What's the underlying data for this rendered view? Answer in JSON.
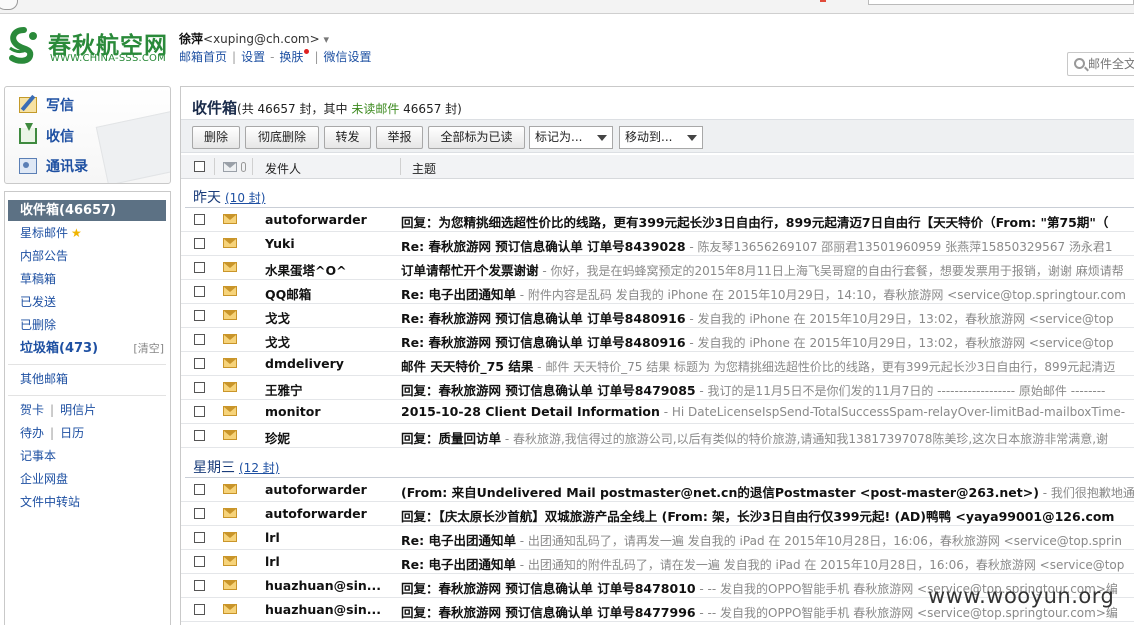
{
  "logo": {
    "cn": "春秋航空网",
    "en": "WWW.CHINA-SSS.COM"
  },
  "user": {
    "name": "徐萍",
    "email": "<xuping@ch.com>",
    "caret": "▾"
  },
  "nav": {
    "home": "邮箱首页",
    "settings": "设置",
    "skin": "换肤",
    "wechat": "微信设置"
  },
  "search": {
    "placeholder": "邮件全文"
  },
  "quick": {
    "write": "写信",
    "inbox": "收信",
    "contacts": "通讯录"
  },
  "folders": {
    "inbox": "收件箱(46657)",
    "starred": "星标邮件",
    "notice": "内部公告",
    "drafts": "草稿箱",
    "sent": "已发送",
    "deleted": "已删除",
    "spam": "垃圾箱(473)",
    "spam_clear": "[清空]",
    "other": "其他邮箱",
    "greeting_card": "贺卡",
    "postcard": "明信片",
    "todo": "待办",
    "calendar": "日历",
    "notes": "记事本",
    "netdisk": "企业网盘",
    "transfer": "文件中转站"
  },
  "header": {
    "title": "收件箱",
    "count_prefix": "(共 46657 封，其中 ",
    "unread_label": "未读邮件",
    "count_suffix": " 46657 封)"
  },
  "toolbar": {
    "delete": "删除",
    "perm_delete": "彻底删除",
    "forward": "转发",
    "report": "举报",
    "mark_all_read": "全部标为已读",
    "mark_as": "标记为...",
    "move_to": "移动到..."
  },
  "columns": {
    "sender": "发件人",
    "subject": "主题"
  },
  "groups": [
    {
      "label": "昨天",
      "count": "(10 封)",
      "emails": [
        {
          "sender": "autoforwarder",
          "subject": "回复：为您精挑细选超性价比的线路，更有399元起长沙3日自由行，899元起清迈7日自由行【天天特价（From: \"第75期\"（",
          "preview": ""
        },
        {
          "sender": "Yuki",
          "subject": "Re: 春秋旅游网 预订信息确认单 订单号8439028",
          "preview": " - 陈友琴13656269107 邵丽君13501960959 张燕萍15850329567 汤永君1"
        },
        {
          "sender": "水果蛋塔^O^",
          "subject": "订单请帮忙开个发票谢谢",
          "preview": " - 你好，我是在蚂蜂窝预定的2015年8月11日上海飞吴哥窟的自由行套餐，想要发票用于报销，谢谢 麻烦请帮"
        },
        {
          "sender": "QQ邮箱",
          "subject": "Re: 电子出团通知单",
          "preview": " - 附件内容是乱码 发自我的 iPhone 在 2015年10月29日，14:10，春秋旅游网 <service@top.springtour.com"
        },
        {
          "sender": "戈戈",
          "subject": "Re: 春秋旅游网 预订信息确认单 订单号8480916",
          "preview": " - 发自我的 iPhone 在 2015年10月29日，13:02，春秋旅游网 <service@top"
        },
        {
          "sender": "戈戈",
          "subject": "Re: 春秋旅游网 预订信息确认单 订单号8480916",
          "preview": " - 发自我的 iPhone 在 2015年10月29日，13:02，春秋旅游网 <service@top"
        },
        {
          "sender": "dmdelivery",
          "subject": "邮件 天天特价_75 结果",
          "preview": " - 邮件 天天特价_75 结果 标题为 为您精挑细选超性价比的线路，更有399元起长沙3日自由行，899元起清迈"
        },
        {
          "sender": "王雅宁",
          "subject": "回复：春秋旅游网 预订信息确认单 订单号8479085",
          "preview": " - 我订的是11月5日不是你们发的11月7日的 ------------------ 原始邮件 --------"
        },
        {
          "sender": "monitor",
          "subject": "2015-10-28 Client Detail Information",
          "preview": " - Hi DateLicenseIspSend-TotalSuccessSpam-relayOver-limitBad-mailboxTime-"
        },
        {
          "sender": "珍妮",
          "subject": "回复：质量回访单",
          "preview": " - 春秋旅游,我信得过的旅游公司,以后有类似的特价旅游,请通知我13817397078陈美珍,这次日本旅游非常满意,谢"
        }
      ]
    },
    {
      "label": "星期三",
      "count": "(12 封)",
      "emails": [
        {
          "sender": "autoforwarder",
          "subject": "(From: 来自Undelivered Mail postmaster@net.cn的退信Postmaster <post-master@263.net>)",
          "preview": " - 我们很抱歉地通知您发"
        },
        {
          "sender": "autoforwarder",
          "subject": "回复：【庆太原长沙首航】双城旅游产品全线上 (From: 架，长沙3日自由行仅399元起! (AD)鸭鸭 <yaya99001@126.com",
          "preview": ""
        },
        {
          "sender": "lrl",
          "subject": "Re: 电子出团通知单",
          "preview": " - 出团通知乱码了，请再发一遍 发自我的 iPad 在 2015年10月28日，16:06，春秋旅游网 <service@top.sprin"
        },
        {
          "sender": "lrl",
          "subject": "Re: 电子出团通知单",
          "preview": " - 出团通知的附件乱码了，请在发一遍 发自我的 iPad 在 2015年10月28日，16:06，春秋旅游网 <service@top"
        },
        {
          "sender": "huazhuan@sin...",
          "subject": "回复：春秋旅游网 预订信息确认单 订单号8478010",
          "preview": " - -- 发自我的OPPO智能手机 春秋旅游网 <service@top.springtour.com>编"
        },
        {
          "sender": "huazhuan@sin...",
          "subject": "回复：春秋旅游网 预订信息确认单 订单号8477996",
          "preview": " - -- 发自我的OPPO智能手机 春秋旅游网 <service@top.springtour.com>编"
        }
      ]
    }
  ],
  "watermark": "www.wooyun.org",
  "colors": {
    "brand_green": "#2a8a3a",
    "link_blue": "#1e50a2",
    "active_folder": "#5c7184",
    "unread_green": "#3c8a1f"
  }
}
